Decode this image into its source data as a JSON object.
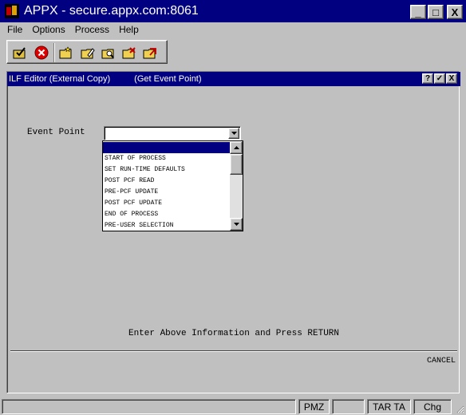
{
  "window": {
    "title": "APPX - secure.appx.com:8061",
    "minimize": "_",
    "maximize": "□",
    "close": "X"
  },
  "menu": [
    "File",
    "Options",
    "Process",
    "Help"
  ],
  "toolbar_icons": [
    "check-folder-icon",
    "cancel-icon",
    "folder-star-icon",
    "folder-edit-icon",
    "folder-search-icon",
    "folder-delete-icon",
    "folder-exit-icon"
  ],
  "dialog": {
    "title_left": "ILF Editor (External Copy)",
    "title_right": "(Get Event Point)",
    "help": "?",
    "ok": "✓",
    "close": "X"
  },
  "form": {
    "event_label": "Event Point",
    "event_value": "",
    "options": [
      "",
      "START OF PROCESS",
      "SET RUN-TIME DEFAULTS",
      "POST PCF READ",
      "PRE-PCF UPDATE",
      "POST PCF UPDATE",
      "END OF PROCESS",
      "PRE-USER SELECTION"
    ],
    "selected_index": 0
  },
  "prompt": "Enter Above Information and Press RETURN",
  "cancel_label": "CANCEL",
  "status": {
    "panels": [
      "",
      "",
      "PMZ",
      "",
      "TAR TA",
      "Chg"
    ]
  }
}
